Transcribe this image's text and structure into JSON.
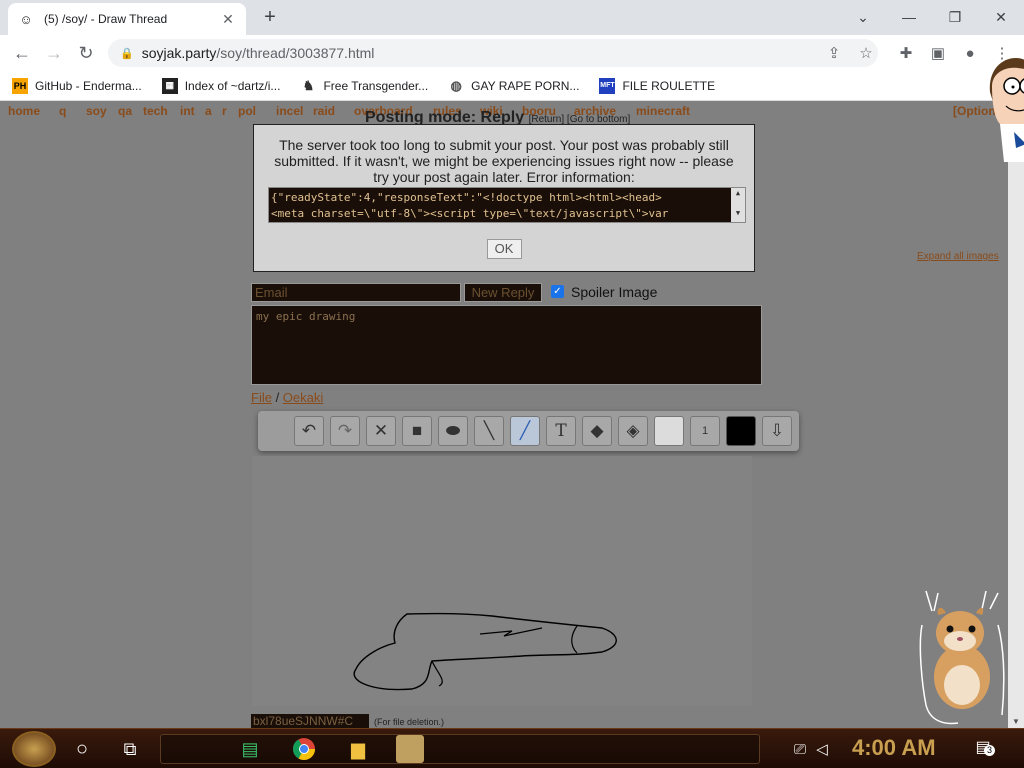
{
  "browser": {
    "tab_title": "(5) /soy/ - Draw Thread",
    "tab_close": "✕",
    "new_tab": "+",
    "url_host": "soyjak.party",
    "url_path": "/soy/thread/3003877.html"
  },
  "bookmarks": [
    {
      "label": "GitHub - Enderma...",
      "icon": "PH",
      "color": "#f7a400"
    },
    {
      "label": "Index of ~dartz/i...",
      "icon": "34",
      "color": "#2a6"
    },
    {
      "label": "Free Transgender...",
      "icon": "pig",
      "color": "#444"
    },
    {
      "label": "GAY RAPE PORN...",
      "icon": "globe",
      "color": "#666"
    },
    {
      "label": "FILE ROULETTE",
      "icon": "MFT",
      "color": "#2040c0"
    }
  ],
  "boardnav": {
    "left": [
      "home",
      "q",
      "soy",
      "qa",
      "tech",
      "int",
      "a",
      "r",
      "pol",
      "incel",
      "raid",
      "overboard",
      "rules",
      "wiki",
      "booru",
      "archive",
      "minecraft"
    ],
    "options": "[Options]"
  },
  "posting_mode": {
    "title": "Posting mode: Reply",
    "links": "[Return] [Go to bottom]"
  },
  "expand_all": "Expand all images",
  "dialog": {
    "message": "The server took too long to submit your post. Your post was probably still submitted. If it wasn't, we might be experiencing issues right now -- please try your post again later. Error information:",
    "error_line1": "{\"readyState\":4,\"responseText\":\"<!doctype html><html><head>",
    "error_line2": "<meta charset=\\\"utf-8\\\"><script type=\\\"text/javascript\\\">var",
    "ok": "OK"
  },
  "form": {
    "email_placeholder": "Email",
    "submit": "New Reply",
    "spoiler_label": "Spoiler Image",
    "spoiler_checked": true,
    "comment": "my epic drawing",
    "file_link": "File",
    "separator": " / ",
    "oekaki_link": "Oekaki",
    "password": "bxl78ueSJNNW#C",
    "password_note": "(For file deletion.)"
  },
  "oekaki_tools": [
    "undo",
    "redo",
    "clear",
    "rectangle",
    "ellipse",
    "line",
    "pen",
    "text",
    "eraser",
    "fill",
    "color-white",
    "size",
    "color-black",
    "export"
  ],
  "oekaki_size": "1",
  "taskbar": {
    "clock": "4:00 AM",
    "notification_count": "3"
  },
  "colors": {
    "board_link": "#8a4b1a",
    "accent_blue": "#1a73e8"
  }
}
